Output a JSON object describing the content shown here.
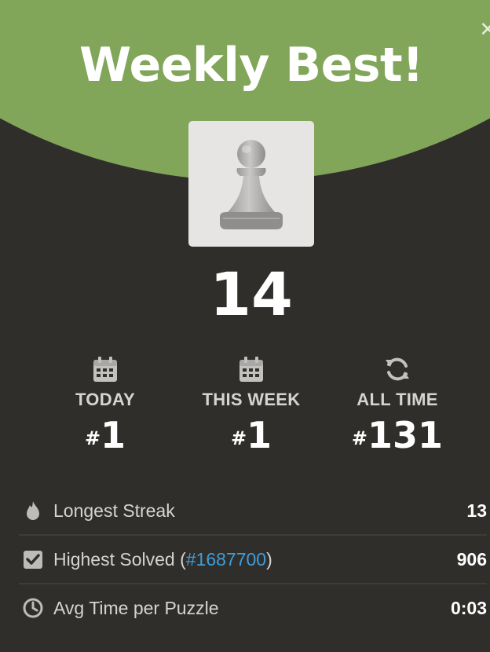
{
  "header": {
    "title": "Weekly Best!",
    "close_icon": "close-icon",
    "accent_color": "#81a65a"
  },
  "avatar": {
    "icon": "pawn-icon"
  },
  "score": "14",
  "ranks": [
    {
      "icon": "calendar-icon",
      "label": "TODAY",
      "hash": "#",
      "value": "1"
    },
    {
      "icon": "calendar-icon",
      "label": "THIS WEEK",
      "hash": "#",
      "value": "1"
    },
    {
      "icon": "refresh-icon",
      "label": "ALL TIME",
      "hash": "#",
      "value": "131"
    }
  ],
  "stats": {
    "longest_streak": {
      "icon": "flame-icon",
      "label": "Longest Streak",
      "value": "13"
    },
    "highest_solved": {
      "icon": "checkbox-icon",
      "label_prefix": "Highest Solved (",
      "link": "#1687700",
      "label_suffix": ")",
      "value": "906",
      "link_color": "#3e9dd8"
    },
    "avg_time": {
      "icon": "clock-icon",
      "label": "Avg Time per Puzzle",
      "value": "0:03"
    }
  },
  "colors": {
    "background": "#302e2b",
    "muted_text": "#d5d4d2"
  }
}
